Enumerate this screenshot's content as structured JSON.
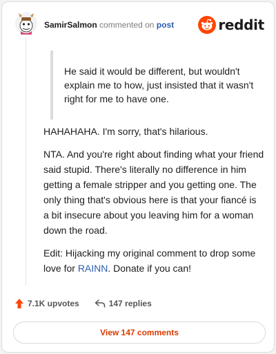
{
  "header": {
    "username": "SamirSalmon",
    "action_text": "commented on",
    "post_link": "post",
    "logo_word": "reddit"
  },
  "comment": {
    "quote": "He said it would be different, but wouldn't explain me to how, just insisted that it wasn't right for me to have one.",
    "paragraphs": [
      "HAHAHAHA. I'm sorry, that's hilarious.",
      "NTA. And you're right about finding what your friend said stupid. There's literally no difference in him getting a female stripper and you getting one. The only thing that's obvious here is that your fiancé is a bit insecure about you leaving him for a woman down the road."
    ],
    "edit_prefix": "Edit: Hijacking my original comment to drop some love for ",
    "edit_link": "RAINN",
    "edit_suffix": ". Donate if you can!"
  },
  "stats": {
    "upvotes": "7.1K upvotes",
    "replies": "147 replies"
  },
  "footer": {
    "view_button": "View 147 comments"
  },
  "icons": {
    "upvote": "upvote-arrow-icon",
    "reply": "reply-arrow-icon",
    "reddit": "reddit-snoo-icon",
    "avatar": "user-avatar"
  },
  "colors": {
    "accent": "#ff4500",
    "link": "#2a5db0",
    "button_text": "#d93a00"
  }
}
